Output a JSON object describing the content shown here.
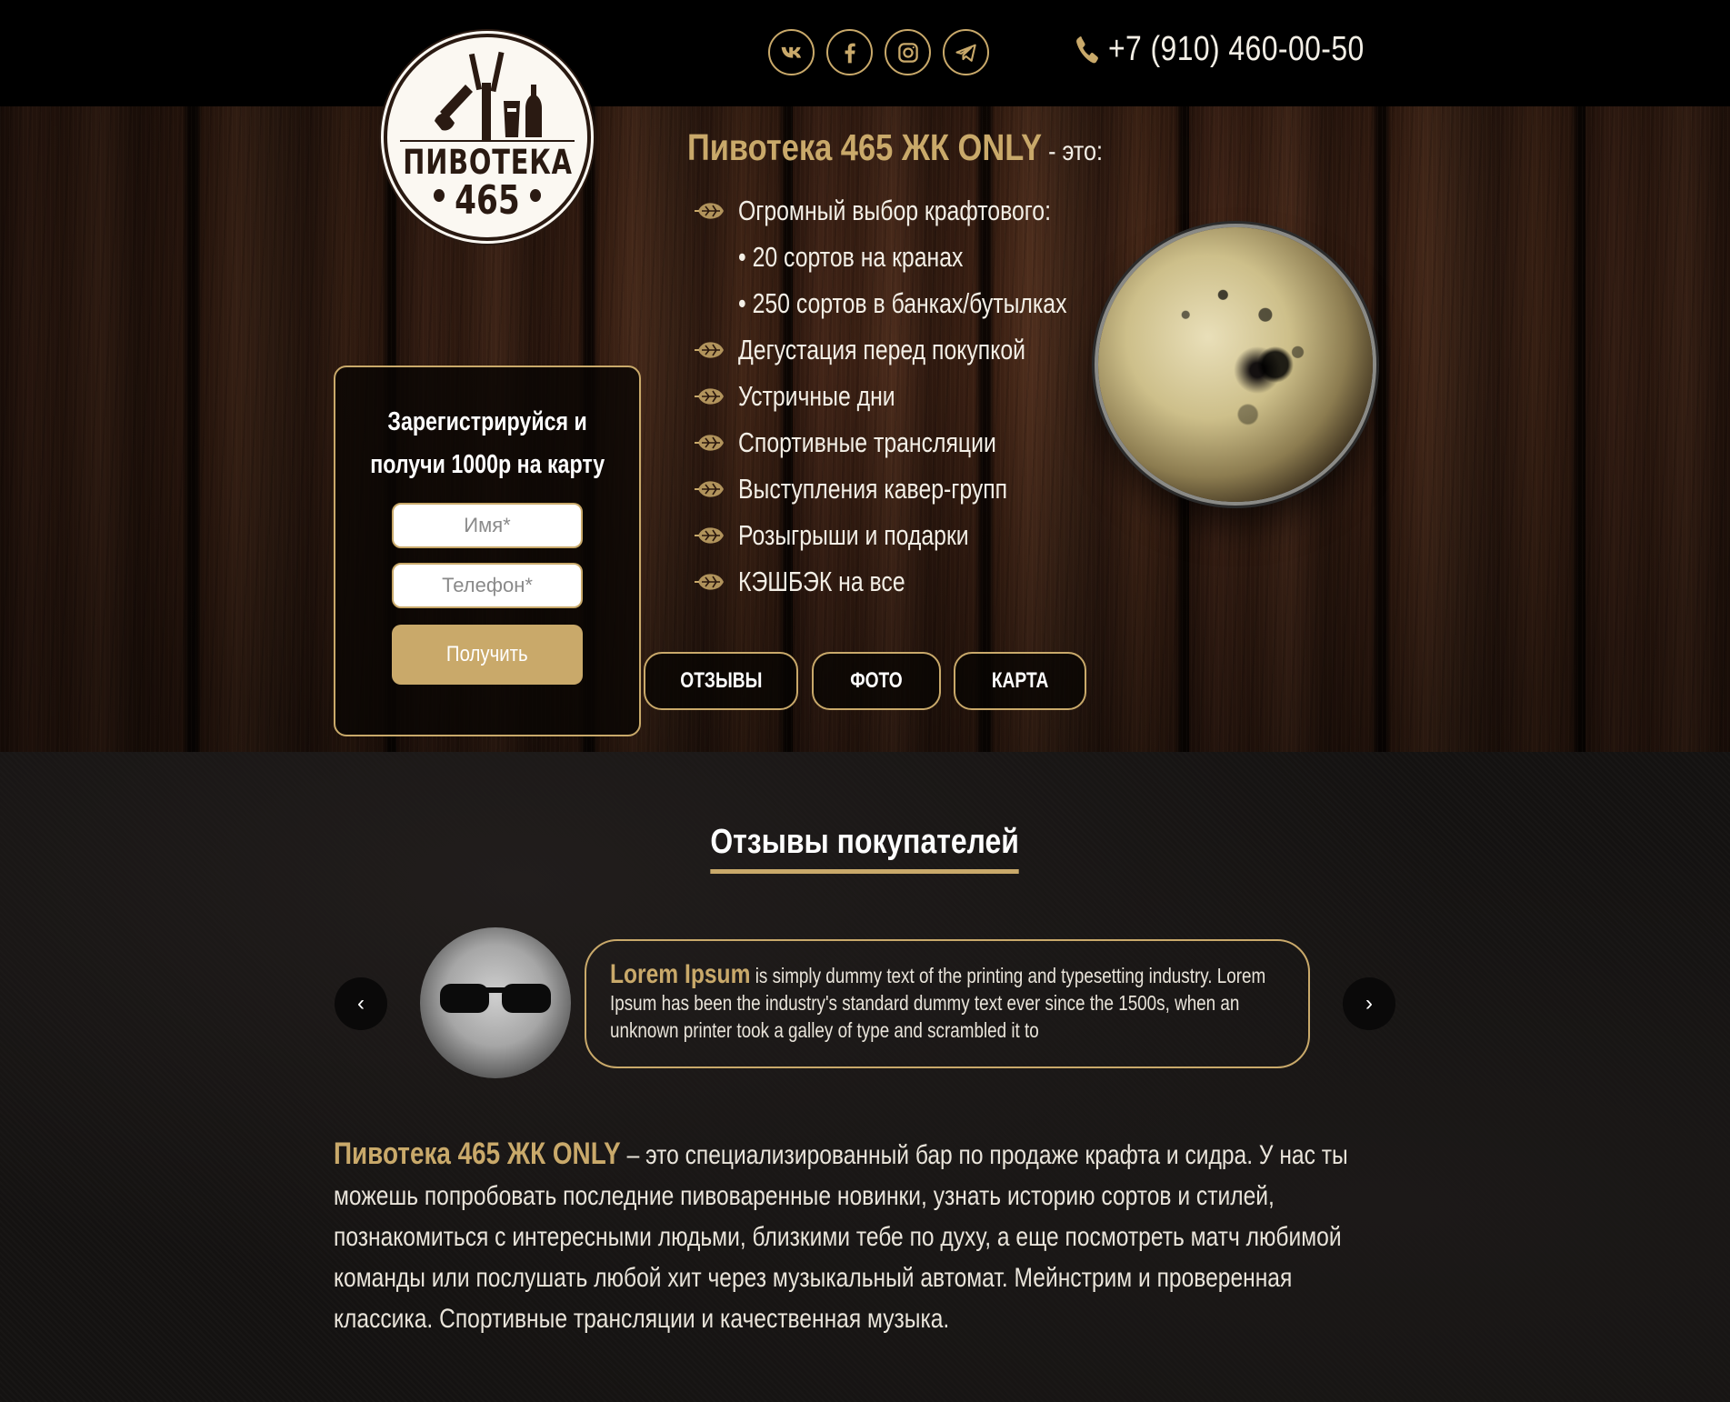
{
  "header": {
    "socials": [
      {
        "name": "vk",
        "icon": "vk-icon"
      },
      {
        "name": "facebook",
        "icon": "facebook-icon"
      },
      {
        "name": "instagram",
        "icon": "instagram-icon"
      },
      {
        "name": "telegram",
        "icon": "telegram-icon"
      }
    ],
    "phone": "+7 (910) 460-00-50"
  },
  "logo": {
    "title": "ПИВОТЕКА",
    "number": "465"
  },
  "form": {
    "title_line1": "Зарегистрируйся и",
    "title_line2": "получи 1000р на карту",
    "name_placeholder": "Имя*",
    "phone_placeholder": "Телефон*",
    "submit_label": "Получить"
  },
  "hero": {
    "brand": "Пивотека 465 ЖК ONLY",
    "suffix": " - это:",
    "features": [
      "Огромный выбор крафтового:",
      "• 20 сортов на кранах",
      "• 250 сортов в банках/бутылках",
      "Дегустация перед покупкой",
      "Устричные дни",
      "Спортивные трансляции",
      "Выступления кавер-групп",
      "Розыгрыши и подарки",
      "КЭШБЭК на все"
    ],
    "buttons": {
      "reviews": "ОТЗЫВЫ",
      "photo": "ФОТО",
      "map": "КАРТА"
    }
  },
  "reviews": {
    "title": "Отзывы покупателей",
    "prev": "‹",
    "next": "›",
    "author": "Lorem Ipsum",
    "text": " is simply dummy text of the printing and typesetting industry. Lorem Ipsum has been the industry's standard dummy text ever since the 1500s, when an unknown printer took a galley of type and scrambled it to"
  },
  "about": {
    "brand": "Пивотека 465 ЖК ONLY",
    "text": " – это специализированный бар по продаже крафта и сидра. У нас ты можешь попробовать последние пивоваренные новинки, узнать историю сортов и стилей, познакомиться с интересными людьми, близкими тебе по духу, а еще посмотреть матч любимой команды или послушать любой хит через музыкальный автомат. Мейнстрим и проверенная классика. Спортивные трансляции и качественная музыка."
  },
  "colors": {
    "accent": "#c9a96a",
    "topbar": "#000000",
    "text": "#f3efe6",
    "section_bg": "#141211"
  }
}
